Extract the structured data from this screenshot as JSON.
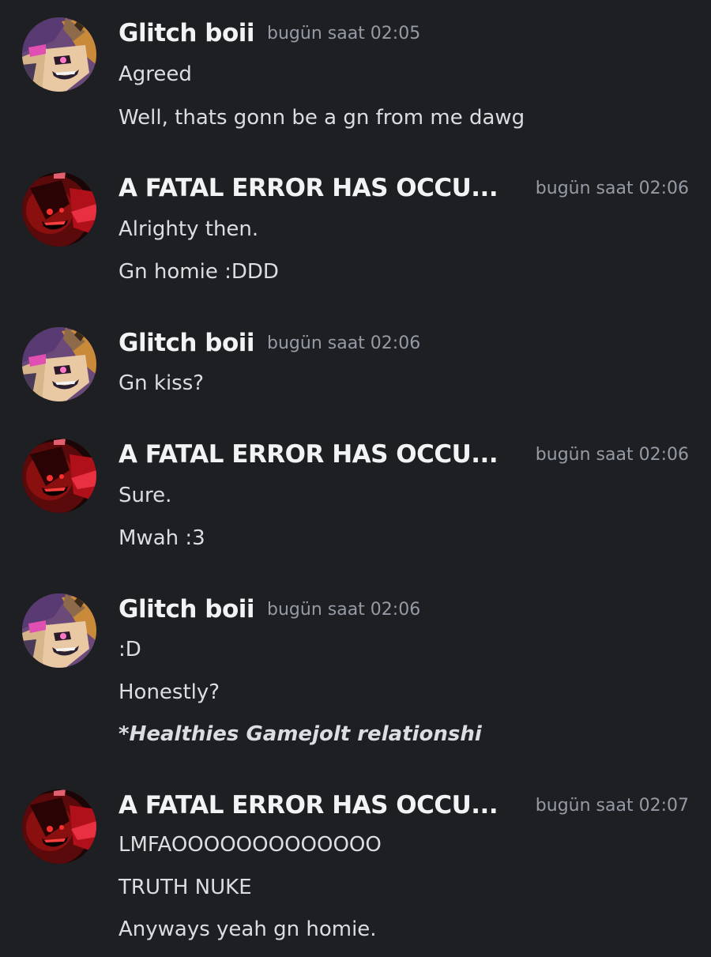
{
  "groups": [
    {
      "username": "Glitch boii",
      "timestamp": "bugün saat 02:05",
      "avatar": "glitch-avatar",
      "messages": [
        "Agreed",
        "Well, thats gonn be a gn from me dawg"
      ]
    },
    {
      "username": "A FATAL ERROR HAS OCCU...",
      "timestamp": "bugün saat 02:06",
      "avatar": "fatal-error-avatar",
      "messages": [
        "Alrighty then.",
        "Gn homie :DDD"
      ]
    },
    {
      "username": "Glitch boii",
      "timestamp": "bugün saat 02:06",
      "avatar": "glitch-avatar",
      "messages": [
        "Gn kiss?"
      ]
    },
    {
      "username": "A FATAL ERROR HAS OCCU...",
      "timestamp": "bugün saat 02:06",
      "avatar": "fatal-error-avatar",
      "messages": [
        "Sure.",
        "Mwah :3"
      ]
    },
    {
      "username": "Glitch boii",
      "timestamp": "bugün saat 02:06",
      "avatar": "glitch-avatar",
      "messages": [
        ":D",
        "Honestly?",
        "*Healthies Gamejolt relationshi"
      ]
    },
    {
      "username": "A FATAL ERROR HAS OCCU...",
      "timestamp": "bugün saat 02:07",
      "avatar": "fatal-error-avatar",
      "messages": [
        "LMFAOOOOOOOOOOOOO",
        "TRUTH NUKE",
        "Anyways yeah gn homie."
      ]
    }
  ],
  "colors": {
    "background": "#1e1f22",
    "username": "#f2f3f5",
    "timestamp": "#949ba4",
    "message": "#dbdee1"
  }
}
